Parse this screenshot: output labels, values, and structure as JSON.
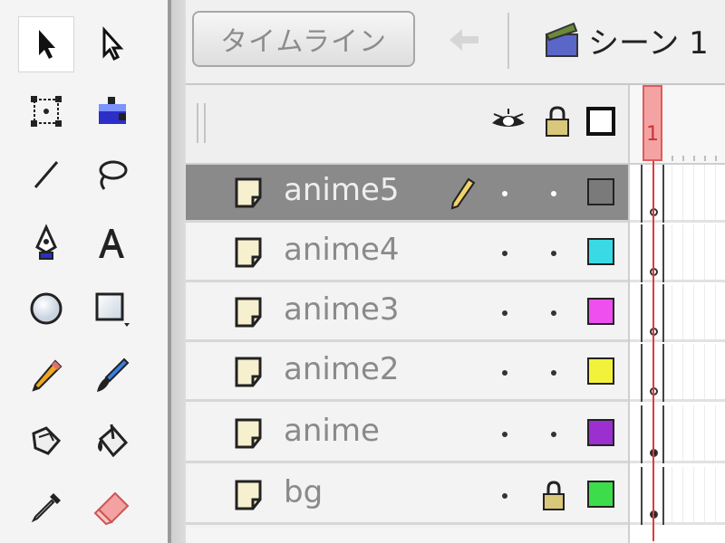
{
  "tools": [
    {
      "name": "selection-tool",
      "icon": "arrow-select-icon",
      "selected": true
    },
    {
      "name": "subselection-tool",
      "icon": "subselect-arrow-icon",
      "selected": false
    },
    {
      "name": "free-transform-tool",
      "icon": "free-transform-icon",
      "selected": false
    },
    {
      "name": "gradient-transform-tool",
      "icon": "gradient-transform-icon",
      "selected": false
    },
    {
      "name": "line-tool",
      "icon": "line-icon",
      "selected": false
    },
    {
      "name": "lasso-tool",
      "icon": "lasso-icon",
      "selected": false
    },
    {
      "name": "pen-tool",
      "icon": "pen-icon",
      "selected": false
    },
    {
      "name": "text-tool",
      "icon": "text-icon",
      "selected": false
    },
    {
      "name": "oval-tool",
      "icon": "oval-icon",
      "selected": false
    },
    {
      "name": "rectangle-tool",
      "icon": "rectangle-icon",
      "selected": false
    },
    {
      "name": "pencil-tool",
      "icon": "pencil-icon",
      "selected": false
    },
    {
      "name": "brush-tool",
      "icon": "brush-icon",
      "selected": false
    },
    {
      "name": "ink-bottle-tool",
      "icon": "ink-bottle-icon",
      "selected": false
    },
    {
      "name": "paint-bucket-tool",
      "icon": "paint-bucket-icon",
      "selected": false
    },
    {
      "name": "eyedropper-tool",
      "icon": "eyedropper-icon",
      "selected": false
    },
    {
      "name": "eraser-tool",
      "icon": "eraser-icon",
      "selected": false
    }
  ],
  "timeline": {
    "tab_label": "タイムライン",
    "scene_label": "シーン 1",
    "header_icons": [
      "eye-icon",
      "lock-icon",
      "outline-icon"
    ],
    "current_frame": "1",
    "layers": [
      {
        "name": "anime5",
        "active": true,
        "editing": true,
        "visible_dot": true,
        "locked": false,
        "color": "#7a7a7a",
        "keyframe": "empty"
      },
      {
        "name": "anime4",
        "active": false,
        "editing": false,
        "visible_dot": true,
        "locked": false,
        "color": "#39d9e6",
        "keyframe": "empty"
      },
      {
        "name": "anime3",
        "active": false,
        "editing": false,
        "visible_dot": true,
        "locked": false,
        "color": "#ee4fee",
        "keyframe": "empty"
      },
      {
        "name": "anime2",
        "active": false,
        "editing": false,
        "visible_dot": true,
        "locked": false,
        "color": "#f2f23a",
        "keyframe": "empty"
      },
      {
        "name": "anime",
        "active": false,
        "editing": false,
        "visible_dot": true,
        "locked": false,
        "color": "#9b2fd0",
        "keyframe": "filled"
      },
      {
        "name": "bg",
        "active": false,
        "editing": false,
        "visible_dot": true,
        "locked": true,
        "color": "#3ddc4a",
        "keyframe": "filled"
      }
    ]
  }
}
